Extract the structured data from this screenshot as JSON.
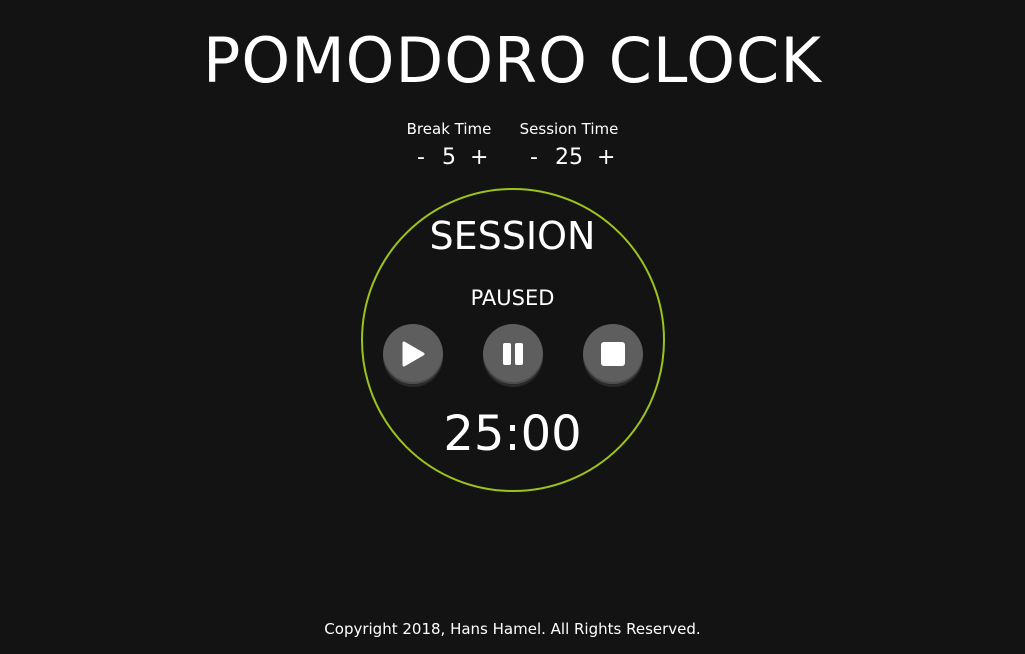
{
  "app": {
    "title": "POMODORO CLOCK"
  },
  "settings": {
    "break": {
      "label": "Break Time",
      "minus": "-",
      "value": "5",
      "plus": "+"
    },
    "session": {
      "label": "Session Time",
      "minus": "-",
      "value": "25",
      "plus": "+"
    }
  },
  "clock": {
    "mode": "SESSION",
    "status": "PAUSED",
    "time": "25:00",
    "ring_color": "#9bc31c"
  },
  "buttons": {
    "play_icon": "play-icon",
    "pause_icon": "pause-icon",
    "stop_icon": "stop-icon"
  },
  "footer": {
    "copyright": "Copyright 2018, Hans Hamel. All Rights Reserved."
  }
}
